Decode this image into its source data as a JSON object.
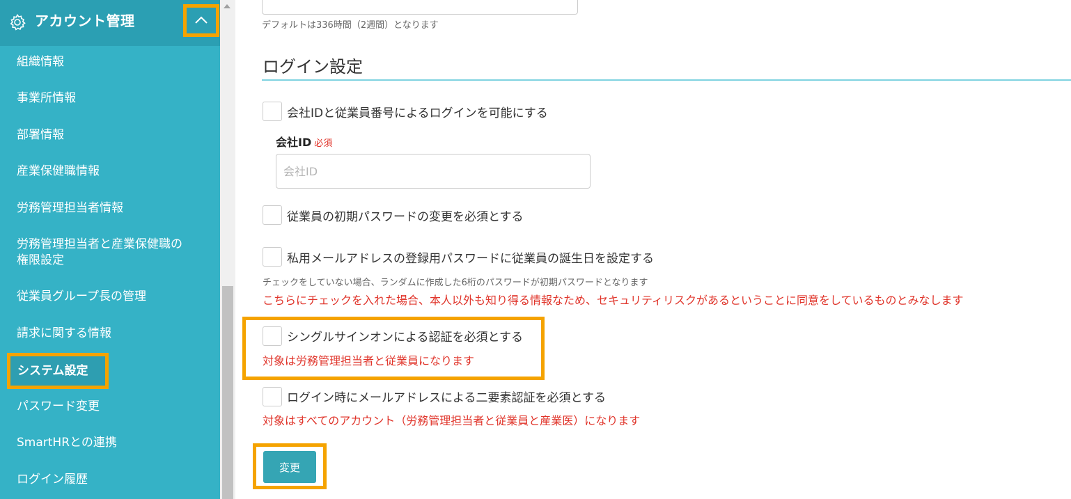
{
  "sidebar": {
    "title": "アカウント管理",
    "header_icon": "gear-icon",
    "collapse_icon": "chevron-up-icon",
    "items": [
      {
        "label": "組織情報"
      },
      {
        "label": "事業所情報"
      },
      {
        "label": "部署情報"
      },
      {
        "label": "産業保健職情報"
      },
      {
        "label": "労務管理担当者情報"
      },
      {
        "label": "労務管理担当者と産業保健職の\n権限設定"
      },
      {
        "label": "従業員グループ長の管理"
      },
      {
        "label": "請求に関する情報"
      },
      {
        "label": "システム設定"
      },
      {
        "label": "パスワード変更"
      },
      {
        "label": "SmartHRとの連携"
      },
      {
        "label": "ログイン履歴"
      }
    ]
  },
  "main": {
    "top_hint": "デフォルトは336時間（2週間）となります",
    "section_title": "ログイン設定",
    "options": [
      {
        "label": "会社IDと従業員番号によるログインを可能にする",
        "checked": false
      },
      {
        "label": "従業員の初期パスワードの変更を必須とする",
        "checked": false
      },
      {
        "label": "私用メールアドレスの登録用パスワードに従業員の誕生日を設定する",
        "checked": false
      },
      {
        "label": "シングルサインオンによる認証を必須とする",
        "checked": false
      },
      {
        "label": "ログイン時にメールアドレスによる二要素認証を必須とする",
        "checked": false
      }
    ],
    "company_id": {
      "label": "会社ID",
      "required": "必須",
      "placeholder": "会社ID",
      "value": ""
    },
    "birthday_hint": "チェックをしていない場合、ランダムに作成した6桁のパスワードが初期パスワードとなります",
    "birthday_warning": "こちらにチェックを入れた場合、本人以外も知り得る情報なため、セキュリティリスクがあるということに同意をしているものとみなします",
    "sso_note": "対象は労務管理担当者と従業員になります",
    "twofa_note": "対象はすべてのアカウント（労務管理担当者と従業員と産業医）になります",
    "submit_label": "変更"
  },
  "colors": {
    "sidebar_bg": "#35b2c6",
    "sidebar_header_bg": "#2b9fb3",
    "highlight": "#f5a300",
    "warning_text": "#e0342a",
    "button_bg": "#35a5b4",
    "section_rule": "#7fd3e0"
  }
}
